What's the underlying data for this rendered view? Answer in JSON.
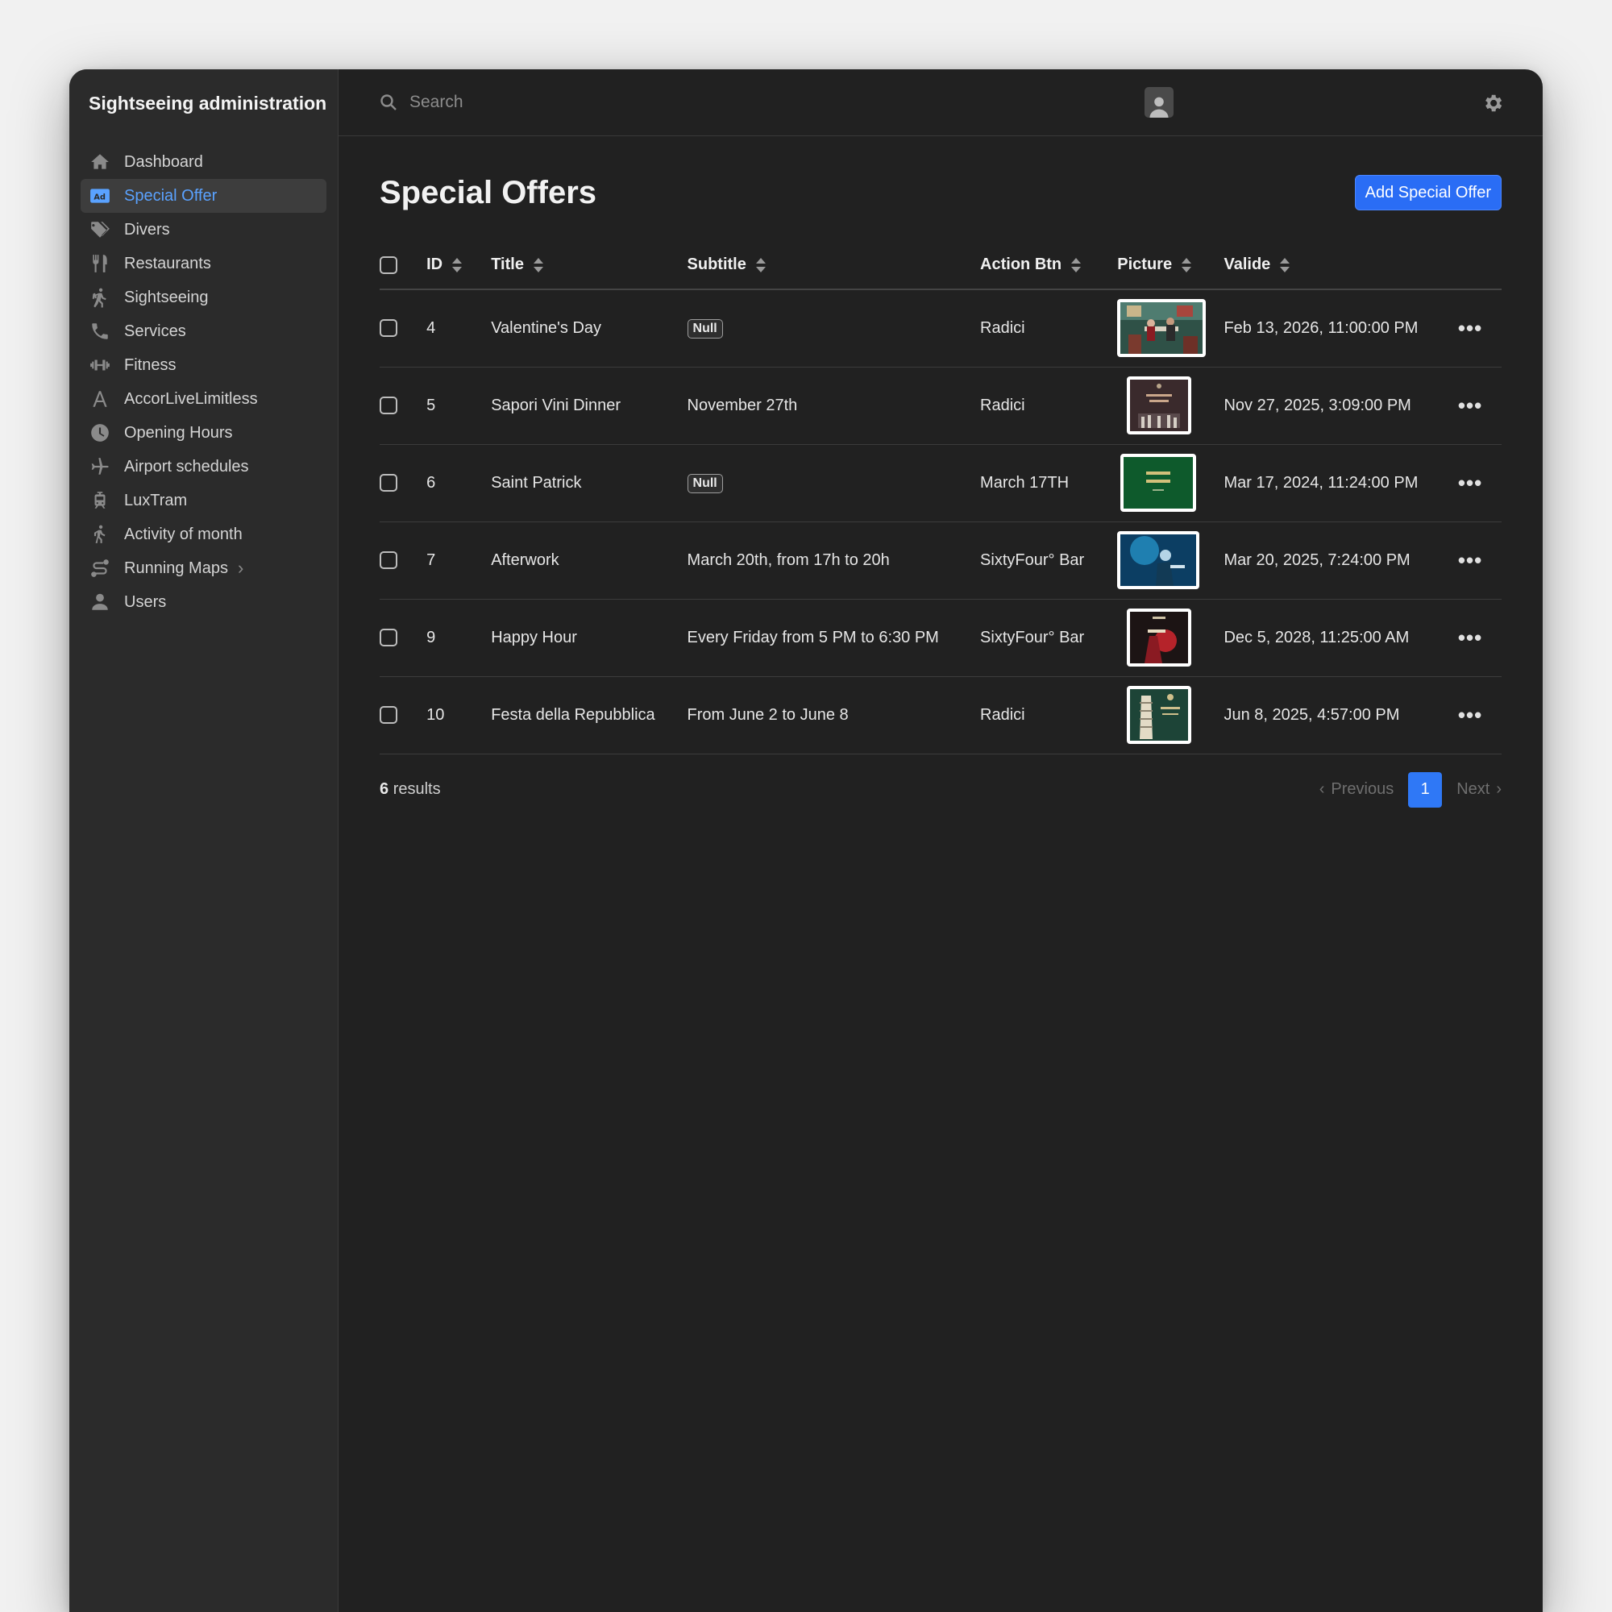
{
  "app_title": "Sightseeing administration",
  "sidebar": {
    "items": [
      {
        "label": "Dashboard",
        "icon": "home-icon"
      },
      {
        "label": "Special Offer",
        "icon": "ad-icon",
        "active": true
      },
      {
        "label": "Divers",
        "icon": "tags-icon"
      },
      {
        "label": "Restaurants",
        "icon": "utensils-icon"
      },
      {
        "label": "Sightseeing",
        "icon": "hiking-icon"
      },
      {
        "label": "Services",
        "icon": "phone-icon"
      },
      {
        "label": "Fitness",
        "icon": "dumbbell-icon"
      },
      {
        "label": "AccorLiveLimitless",
        "icon": "letter-a-icon"
      },
      {
        "label": "Opening Hours",
        "icon": "clock-icon"
      },
      {
        "label": "Airport schedules",
        "icon": "plane-icon"
      },
      {
        "label": "LuxTram",
        "icon": "tram-icon"
      },
      {
        "label": "Activity of month",
        "icon": "walking-icon"
      },
      {
        "label": "Running Maps",
        "icon": "route-icon",
        "has_submenu": true
      },
      {
        "label": "Users",
        "icon": "user-icon"
      }
    ]
  },
  "topbar": {
    "search_placeholder": "Search"
  },
  "page": {
    "title": "Special Offers",
    "add_button": "Add Special Offer"
  },
  "table": {
    "columns": [
      "ID",
      "Title",
      "Subtitle",
      "Action Btn",
      "Picture",
      "Valide"
    ],
    "rows": [
      {
        "id": "4",
        "title": "Valentine's Day",
        "subtitle": "Null",
        "subtitle_null": true,
        "action": "Radici",
        "picture": "restaurant-scene",
        "valide": "Feb 13, 2026, 11:00:00 PM"
      },
      {
        "id": "5",
        "title": "Sapori Vini Dinner",
        "subtitle": "November 27th",
        "subtitle_null": false,
        "action": "Radici",
        "picture": "sapori-vini-poster",
        "valide": "Nov 27, 2025, 3:09:00 PM"
      },
      {
        "id": "6",
        "title": "Saint Patrick",
        "subtitle": "Null",
        "subtitle_null": true,
        "action": "March 17TH",
        "picture": "sixty-four-green-poster",
        "valide": "Mar 17, 2024, 11:24:00 PM"
      },
      {
        "id": "7",
        "title": "Afterwork",
        "subtitle": "March 20th, from 17h to 20h",
        "subtitle_null": false,
        "action": "SixtyFour° Bar",
        "picture": "blue-concert-photo",
        "valide": "Mar 20, 2025, 7:24:00 PM"
      },
      {
        "id": "9",
        "title": "Happy Hour",
        "subtitle": "Every Friday from 5 PM to 6:30 PM",
        "subtitle_null": false,
        "action": "SixtyFour° Bar",
        "picture": "happy-hour-poster",
        "valide": "Dec 5, 2028, 11:25:00 AM"
      },
      {
        "id": "10",
        "title": "Festa della Repubblica",
        "subtitle": "From June 2 to June 8",
        "subtitle_null": false,
        "action": "Radici",
        "picture": "italian-festival-poster",
        "valide": "Jun 8, 2025, 4:57:00 PM"
      }
    ]
  },
  "footer": {
    "results_count": "6",
    "results_label": "results",
    "previous": "Previous",
    "current_page": "1",
    "next": "Next"
  },
  "colors": {
    "accent": "#2a6df5",
    "active_nav_text": "#5aa2ff",
    "sidebar_bg": "#2b2b2b",
    "main_bg": "#212121"
  }
}
